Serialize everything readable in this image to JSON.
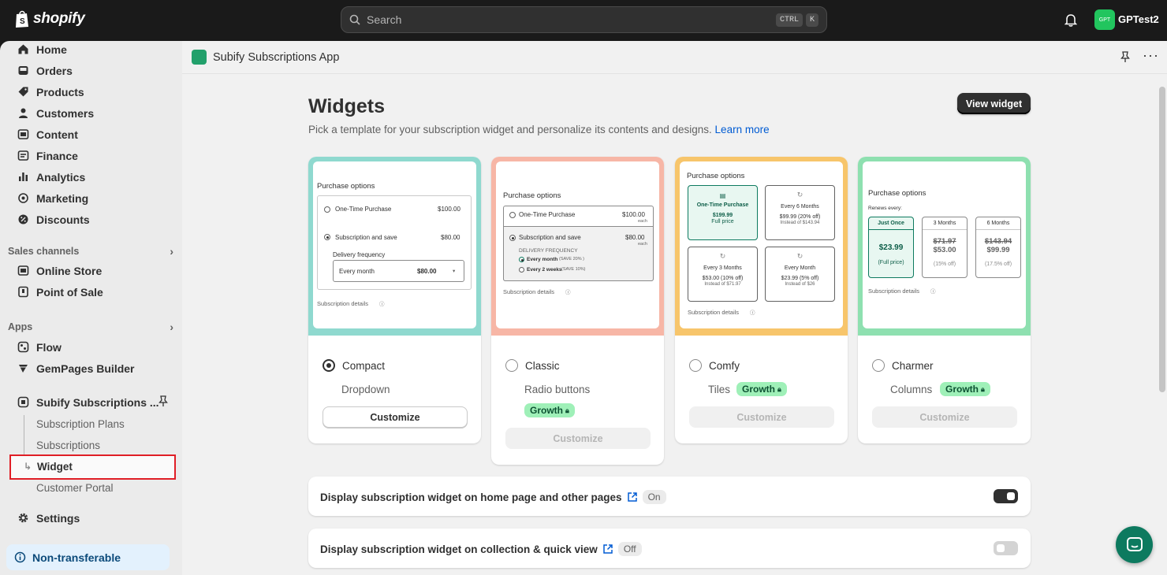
{
  "topbar": {
    "logo_text": "shopify",
    "search_placeholder": "Search",
    "kbd_ctrl": "CTRL",
    "kbd_k": "K",
    "avatar_text": "GPT",
    "store_name": "GPTest2"
  },
  "sidebar": {
    "items": [
      {
        "label": "Home",
        "icon": "home-icon"
      },
      {
        "label": "Orders",
        "icon": "inbox-icon"
      },
      {
        "label": "Products",
        "icon": "tag-icon"
      },
      {
        "label": "Customers",
        "icon": "person-icon"
      },
      {
        "label": "Content",
        "icon": "image-icon"
      },
      {
        "label": "Finance",
        "icon": "bank-icon"
      },
      {
        "label": "Analytics",
        "icon": "bar-chart-icon"
      },
      {
        "label": "Marketing",
        "icon": "target-icon"
      },
      {
        "label": "Discounts",
        "icon": "discount-icon"
      }
    ],
    "sales_channels_label": "Sales channels",
    "channels": [
      {
        "label": "Online Store",
        "icon": "store-icon"
      },
      {
        "label": "Point of Sale",
        "icon": "pos-icon"
      }
    ],
    "apps_label": "Apps",
    "apps": [
      {
        "label": "Flow",
        "icon": "flow-icon"
      },
      {
        "label": "GemPages Builder",
        "icon": "gempages-icon"
      },
      {
        "label": "Subify Subscriptions ...",
        "icon": "subify-icon"
      }
    ],
    "sub_items": [
      "Subscription Plans",
      "Subscriptions",
      "Widget",
      "Customer Portal"
    ],
    "settings_label": "Settings",
    "nontransferable_label": "Non-transferable"
  },
  "appbar": {
    "title": "Subify Subscriptions App"
  },
  "page": {
    "title": "Widgets",
    "subtitle": "Pick a template for your subscription widget and personalize its contents and designs.",
    "learn_more": "Learn more",
    "view_widget": "View widget"
  },
  "templates": [
    {
      "name": "Compact",
      "style": "Dropdown",
      "badge": "",
      "customize": "Customize",
      "selected": true,
      "color": "#8fd9cf"
    },
    {
      "name": "Classic",
      "style": "Radio buttons",
      "badge": "Growth",
      "customize": "Customize",
      "selected": false,
      "color": "#f7b6a6"
    },
    {
      "name": "Comfy",
      "style": "Tiles",
      "badge": "Growth",
      "customize": "Customize",
      "selected": false,
      "color": "#f7c56b"
    },
    {
      "name": "Charmer",
      "style": "Columns",
      "badge": "Growth",
      "customize": "Customize",
      "selected": false,
      "color": "#8ee0b0"
    }
  ],
  "previews": {
    "purchase_options": "Purchase options",
    "subscription_details": "Subscription details",
    "compact": {
      "one_time": "One-Time Purchase",
      "one_time_price": "$100.00",
      "sub_save": "Subscription and save",
      "sub_price": "$80.00",
      "delivery_frequency": "Delivery frequency",
      "every_month": "Every month",
      "every_month_price": "$80.00"
    },
    "classic": {
      "one_time": "One-Time Purchase",
      "one_time_price": "$100.00",
      "each": "each",
      "sub_save": "Subscription and save",
      "sub_price": "$80.00",
      "delivery_frequency": "DELIVERY FREQUENCY",
      "opt1": "Every month",
      "opt1_save": "(SAVE 20% )",
      "opt2": "Every 2 weeks",
      "opt2_save": "(SAVE 10%)"
    },
    "comfy": {
      "t1_title": "One-Time Purchase",
      "t1_price": "$199.99",
      "t1_note": "Full price",
      "t2_title": "Every 6 Months",
      "t2_price": "$99.99 (20% off)",
      "t2_note": "Instead of $143.94",
      "t3_title": "Every 3 Months",
      "t3_price": "$53.00 (10% off)",
      "t3_note": "Instead of $71.97",
      "t4_title": "Every Month",
      "t4_price": "$23.99 (5% off)",
      "t4_note": "Instead of $26"
    },
    "charmer": {
      "renews_every": "Renews every:",
      "c1_title": "Just Once",
      "c1_price": "$23.99",
      "c1_note": "(Full price)",
      "c2_title": "3 Months",
      "c2_old": "$71.97",
      "c2_price": "$53.00",
      "c2_note": "(15% off)",
      "c3_title": "6 Months",
      "c3_old": "$143.94",
      "c3_price": "$99.99",
      "c3_note": "(17.5% off)"
    }
  },
  "toggles": [
    {
      "label": "Display subscription widget on home page and other pages",
      "state": "On"
    },
    {
      "label": "Display subscription widget on collection & quick view",
      "state": "Off"
    }
  ]
}
